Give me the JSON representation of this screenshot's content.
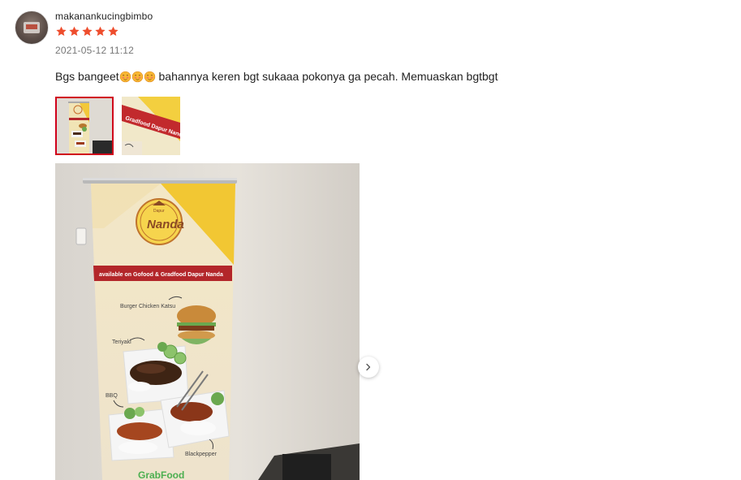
{
  "review": {
    "username": "makanankucingbimbo",
    "rating": 5,
    "rating_max": 5,
    "timestamp": "2021-05-12 11:12",
    "comment_before_emoji": "Bgs bangeet",
    "emoji_name": "hot-face-emoji",
    "emoji_count": 3,
    "comment_after_emoji": " bahannya keren bgt sukaaa pokonya ga pecah. Memuaskan bgtbgt"
  },
  "colors": {
    "star": "#ee4d2d",
    "selected_thumb_border": "#d0011b",
    "text_primary": "#222222",
    "text_secondary": "#777777"
  },
  "media": {
    "thumbnails": [
      {
        "name": "thumbnail-banner-full",
        "selected": true
      },
      {
        "name": "thumbnail-banner-closeup",
        "selected": false
      }
    ],
    "main_photo": {
      "brand_top": "Dapur",
      "brand_name": "Nanda",
      "banner_text": "available on Gofood & Gradfood Dapur Nanda",
      "menu_items": [
        "Burger Chicken Katsu",
        "Teriyaki",
        "BBQ",
        "Blackpepper"
      ],
      "footer_brand": "GrabFood",
      "closeup_text": "Gradfood Dapur Nanda"
    },
    "next_icon": "chevron-right-icon"
  }
}
